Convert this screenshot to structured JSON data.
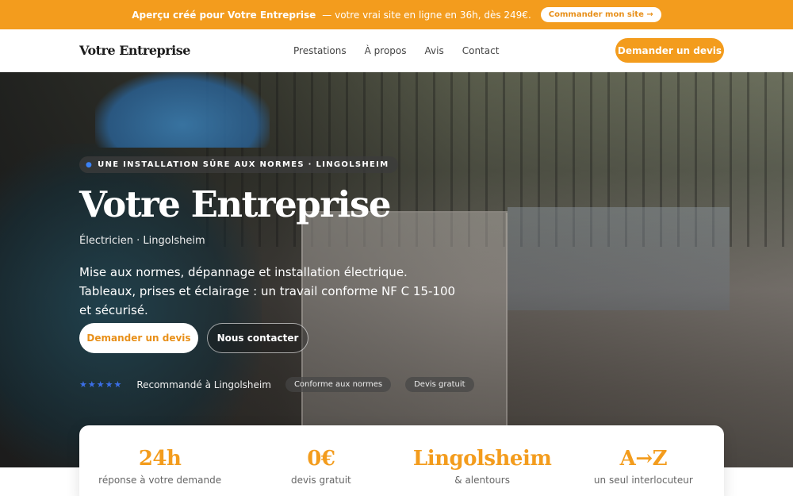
{
  "topbar": {
    "brand": "Aperçu créé pour Votre Entreprise",
    "text": "— votre vrai site en ligne en 36h, dès 249€.",
    "cta": "Commander mon site →"
  },
  "nav": {
    "logo": "Votre Entreprise",
    "links": [
      "Prestations",
      "À propos",
      "Avis",
      "Contact"
    ],
    "quote_button": "Demander un devis"
  },
  "hero": {
    "badge": "UNE INSTALLATION SÛRE AUX NORMES · LINGOLSHEIM",
    "title": "Votre Entreprise",
    "subtitle": "Électricien · Lingolsheim",
    "description": "Mise aux normes, dépannage et installation électrique. Tableaux, prises et éclairage : un travail conforme NF C 15-100 et sécurisé.",
    "primary_button": "Demander un devis",
    "secondary_button": "Nous contacter",
    "rating_stars": "★★★★★",
    "rating_text": "Recommandé à Lingolsheim",
    "pills": [
      "Conforme aux normes",
      "Devis gratuit"
    ]
  },
  "stats": [
    {
      "value": "24h",
      "label": "réponse à votre demande"
    },
    {
      "value": "0€",
      "label": "devis gratuit"
    },
    {
      "value": "Lingolsheim",
      "label": "& alentours"
    },
    {
      "value": "A→Z",
      "label": "un seul interlocuteur"
    }
  ],
  "colors": {
    "accent": "#f39c1d",
    "star": "#3b6fe8"
  }
}
